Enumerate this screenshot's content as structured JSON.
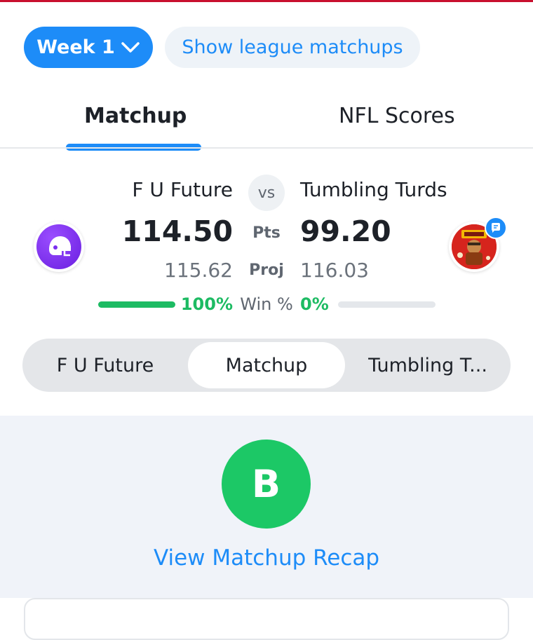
{
  "header": {
    "week_label": "Week 1",
    "league_matchups_label": "Show league matchups"
  },
  "tabs": [
    {
      "label": "Matchup",
      "active": true
    },
    {
      "label": "NFL Scores",
      "active": false
    }
  ],
  "matchup": {
    "vs_label": "vs",
    "pts_label": "Pts",
    "proj_label": "Proj",
    "win_label": "Win %",
    "team_left": {
      "name": "F U Future",
      "points": "114.50",
      "projected": "115.62",
      "win_pct_text": "100%",
      "win_pct": 100,
      "avatar_icon": "helmet-icon"
    },
    "team_right": {
      "name": "Tumbling Turds",
      "points": "99.20",
      "projected": "116.03",
      "win_pct_text": "0%",
      "win_pct": 0,
      "avatar_icon": "team-logo-image"
    }
  },
  "segments": [
    {
      "label": "F U Future",
      "selected": false
    },
    {
      "label": "Matchup",
      "selected": true
    },
    {
      "label": "Tumbling T...",
      "selected": false
    }
  ],
  "recap": {
    "grade": "B",
    "link_label": "View Matchup Recap"
  },
  "colors": {
    "accent": "#1d8cf8",
    "win": "#1dbb63",
    "grade": "#1cc866",
    "top_bar": "#c8102e"
  }
}
